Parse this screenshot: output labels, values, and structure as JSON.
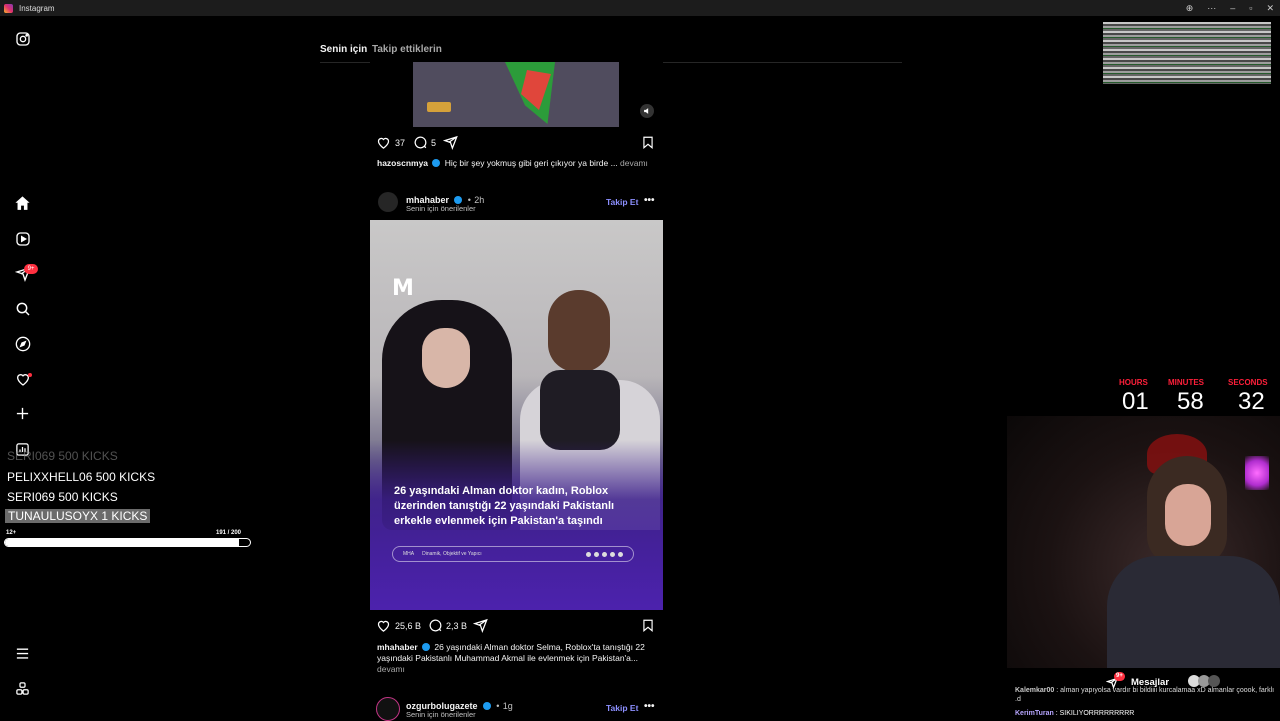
{
  "window": {
    "title": "Instagram"
  },
  "nav": {
    "notifications_badge": "9+"
  },
  "kicks": {
    "lines": [
      {
        "text": "SERI069  500 KICKS"
      },
      {
        "text": "PELIXXHELL06  500 KICKS"
      },
      {
        "text": "SERI069  500 KICKS"
      },
      {
        "text": "TUNAULUSOYX  1 KICKS"
      }
    ],
    "progress": {
      "left_label": "12+",
      "right_label": "191 / 200",
      "value": 0.955
    }
  },
  "feed": {
    "tabs": [
      {
        "label": "Senin için"
      },
      {
        "label": "Takip ettiklerin"
      }
    ],
    "post1": {
      "likes": "37",
      "comments": "5",
      "username": "hazoscnmya",
      "caption": "Hiç bir şey yokmuş gibi geri çıkıyor ya birde ...",
      "more": "devamı"
    },
    "post2": {
      "username": "mhahaber",
      "time": "2h",
      "suggestion": "Senin için önerilenler",
      "follow": "Takip Et",
      "image_headline": "26 yaşındaki Alman doktor kadın, Roblox üzerinden tanıştığı 22 yaşındaki Pakistanlı erkekle evlenmek için Pakistan'a taşındı",
      "image_logo": "M",
      "image_footer_brand": "MHA",
      "image_footer_tagline": "Dinamik, Objektif ve Yapıcı",
      "likes": "25,6 B",
      "comments": "2,3 B",
      "caption": "26 yaşındaki Alman doktor Selma, Roblox'ta tanıştığı 22 yaşındaki Pakistanlı Muhammad Akmal ile evlenmek için Pakistan'a...",
      "more": "devamı"
    },
    "post3": {
      "username": "ozgurbolugazete",
      "time": "1g",
      "suggestion": "Senin için önerilenler",
      "follow": "Takip Et"
    }
  },
  "timer": {
    "hours_label": "HOURS",
    "hours": "01",
    "minutes_label": "MINUTES",
    "minutes": "58",
    "seconds_label": "SECONDS",
    "seconds": "32"
  },
  "chat": [
    {
      "user": "Kalemkar00",
      "text": ": alman yapıyolsa vardır bi bildiiii kurcalamaa xD almanlar çoook, farklı .d"
    },
    {
      "user": "KerimTuran",
      "text": ": SIKILIYORRRRRRRRR"
    }
  ],
  "messages": {
    "label": "Mesajlar",
    "badge": "9+"
  }
}
